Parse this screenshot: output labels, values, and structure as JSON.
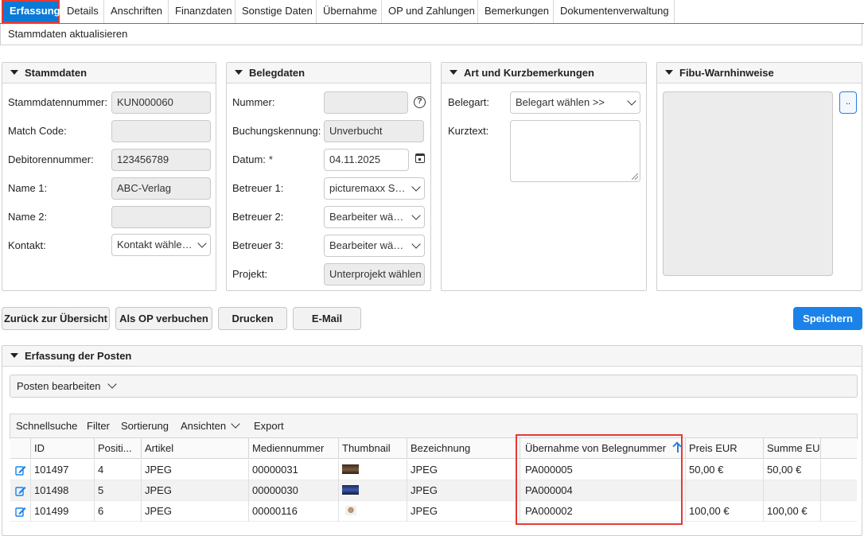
{
  "tabs": [
    {
      "label": "Erfassung"
    },
    {
      "label": "Details"
    },
    {
      "label": "Anschriften"
    },
    {
      "label": "Finanzdaten"
    },
    {
      "label": "Sonstige Daten"
    },
    {
      "label": "Übernahme"
    },
    {
      "label": "OP und Zahlungen"
    },
    {
      "label": "Bemerkungen"
    },
    {
      "label": "Dokumentenverwaltung"
    }
  ],
  "subbar": {
    "label": "Stammdaten aktualisieren"
  },
  "stammdaten": {
    "title": "Stammdaten",
    "nummer_label": "Stammdatennummer:",
    "nummer_value": "KUN000060",
    "match_label": "Match Code:",
    "match_value": "",
    "debitor_label": "Debitorennummer:",
    "debitor_value": "123456789",
    "name1_label": "Name 1:",
    "name1_value": "ABC-Verlag",
    "name2_label": "Name 2:",
    "name2_value": "",
    "kontakt_label": "Kontakt:",
    "kontakt_value": "Kontakt wählen..."
  },
  "belegdaten": {
    "title": "Belegdaten",
    "nummer_label": "Nummer:",
    "nummer_value": "",
    "buchung_label": "Buchungskennung:",
    "buchung_value": "Unverbucht",
    "datum_label": "Datum:",
    "datum_required": "*",
    "datum_value": "04.11.2025",
    "betreuer1_label": "Betreuer 1:",
    "betreuer1_value": "picturemaxx Su...",
    "betreuer2_label": "Betreuer 2:",
    "betreuer2_value": "Bearbeiter wäh...",
    "betreuer3_label": "Betreuer 3:",
    "betreuer3_value": "Bearbeiter wäh...",
    "projekt_label": "Projekt:",
    "projekt_value": "Unterprojekt wählen"
  },
  "art": {
    "title": "Art und Kurzbemerkungen",
    "belegart_label": "Belegart:",
    "belegart_value": "Belegart wählen >>",
    "kurztext_label": "Kurztext:"
  },
  "fibu": {
    "title": "Fibu-Warnhinweise",
    "button_label": ".."
  },
  "actions": {
    "back": "Zurück zur Übersicht",
    "op": "Als OP verbuchen",
    "print": "Drucken",
    "email": "E-Mail",
    "save": "Speichern"
  },
  "posten": {
    "title": "Erfassung der Posten",
    "edit_label": "Posten bearbeiten",
    "toolbar": {
      "quick": "Schnellsuche",
      "filter": "Filter",
      "sort": "Sortierung",
      "views": "Ansichten",
      "export": "Export"
    },
    "columns": [
      "ID",
      "Positi...",
      "Artikel",
      "Mediennummer",
      "Thumbnail",
      "Bezeichnung",
      "Übernahme von Belegnummer",
      "Preis EUR",
      "Summe EUR"
    ],
    "rows": [
      {
        "id": "101497",
        "pos": "4",
        "artikel": "JPEG",
        "medien": "00000031",
        "bez": "JPEG",
        "beleg": "PA000005",
        "preis": "50,00 €",
        "summe": "50,00 €"
      },
      {
        "id": "101498",
        "pos": "5",
        "artikel": "JPEG",
        "medien": "00000030",
        "bez": "JPEG",
        "beleg": "PA000004",
        "preis": "",
        "summe": ""
      },
      {
        "id": "101499",
        "pos": "6",
        "artikel": "JPEG",
        "medien": "00000116",
        "bez": "JPEG",
        "beleg": "PA000002",
        "preis": "100,00 €",
        "summe": "100,00 €"
      }
    ]
  },
  "colors": {
    "accent": "#1a82e8",
    "highlight": "#e53935"
  }
}
